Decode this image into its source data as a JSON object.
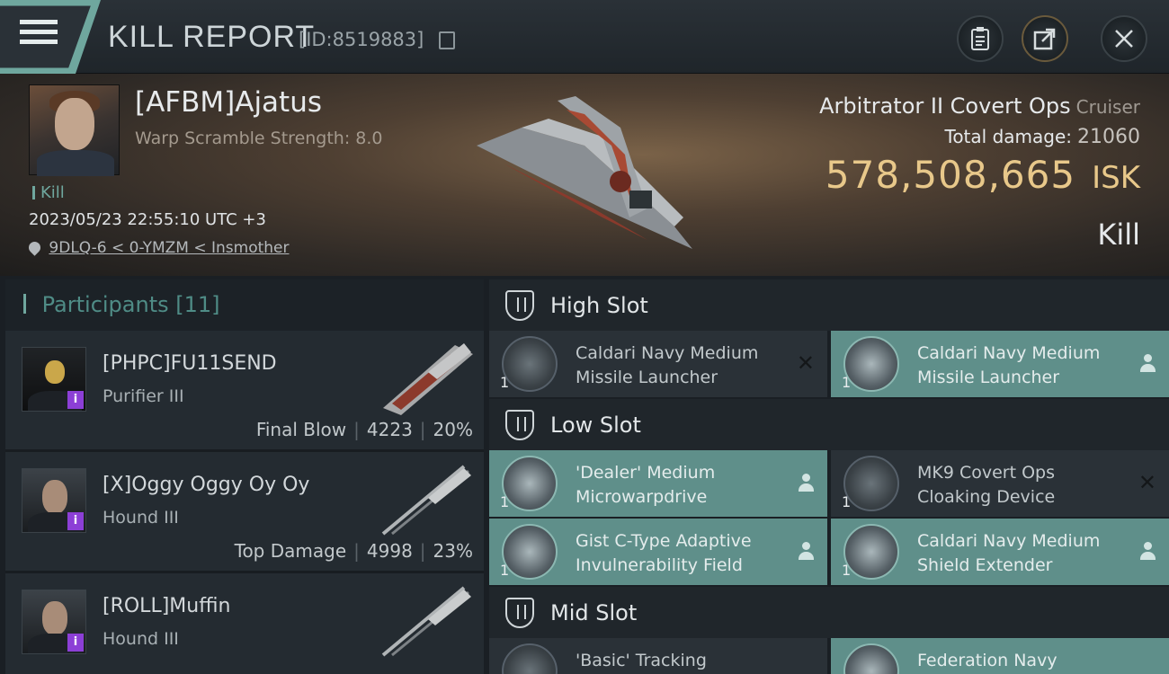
{
  "header": {
    "title": "KILL REPORT",
    "report_id": "[ID:8519883]",
    "icons": [
      "menu-icon",
      "copy-icon",
      "clipboard-icon",
      "share-icon",
      "close-icon"
    ]
  },
  "victim": {
    "name": "[AFBM]Ajatus",
    "warp_scramble": "Warp Scramble Strength: 8.0",
    "tag": "Kill",
    "timestamp": "2023/05/23 22:55:10 UTC +3",
    "location": "9DLQ-6 < 0-YMZM < Insmother",
    "ship_name": "Arbitrator II Covert Ops",
    "ship_class": "Cruiser",
    "total_damage_label": "Total damage:",
    "total_damage": "21060",
    "isk_value": "578,508,665",
    "isk_unit": "ISK",
    "result": "Kill"
  },
  "participants": {
    "title": "Participants",
    "count": "[11]",
    "items": [
      {
        "name": "[PHPC]FU11SEND",
        "ship": "Purifier III",
        "role": "Final Blow",
        "damage": "4223",
        "percent": "20%"
      },
      {
        "name": "[X]Oggy Oggy Oy Oy",
        "ship": "Hound III",
        "role": "Top Damage",
        "damage": "4998",
        "percent": "23%"
      },
      {
        "name": "[ROLL]Muffin",
        "ship": "Hound III",
        "role": "",
        "damage": "",
        "percent": ""
      }
    ]
  },
  "fitting": {
    "high_slot": {
      "label": "High Slot",
      "modules": [
        {
          "qty": "1",
          "name": "Caldari Navy Medium Missile Launcher",
          "status": "destroyed"
        },
        {
          "qty": "1",
          "name": "Caldari Navy Medium Missile Launcher",
          "status": "dropped"
        }
      ]
    },
    "low_slot": {
      "label": "Low Slot",
      "modules": [
        {
          "qty": "1",
          "name": "'Dealer' Medium Microwarpdrive",
          "status": "dropped"
        },
        {
          "qty": "1",
          "name": "MK9 Covert Ops Cloaking Device",
          "status": "destroyed"
        },
        {
          "qty": "1",
          "name": "Gist C-Type Adaptive Invulnerability Field",
          "status": "dropped"
        },
        {
          "qty": "1",
          "name": "Caldari Navy Medium Shield Extender",
          "status": "dropped"
        }
      ]
    },
    "mid_slot": {
      "label": "Mid Slot",
      "modules": [
        {
          "qty": "1",
          "name": "'Basic' Tracking",
          "status": "destroyed"
        },
        {
          "qty": "1",
          "name": "Federation Navy",
          "status": "dropped"
        }
      ]
    }
  },
  "colors": {
    "accent_teal": "#6fa79e",
    "isk_gold": "#e8c88a",
    "dropped_bg": "#5f8f8a",
    "destroyed_bg": "#2a3137",
    "badge_purple": "#8c3fd6"
  }
}
